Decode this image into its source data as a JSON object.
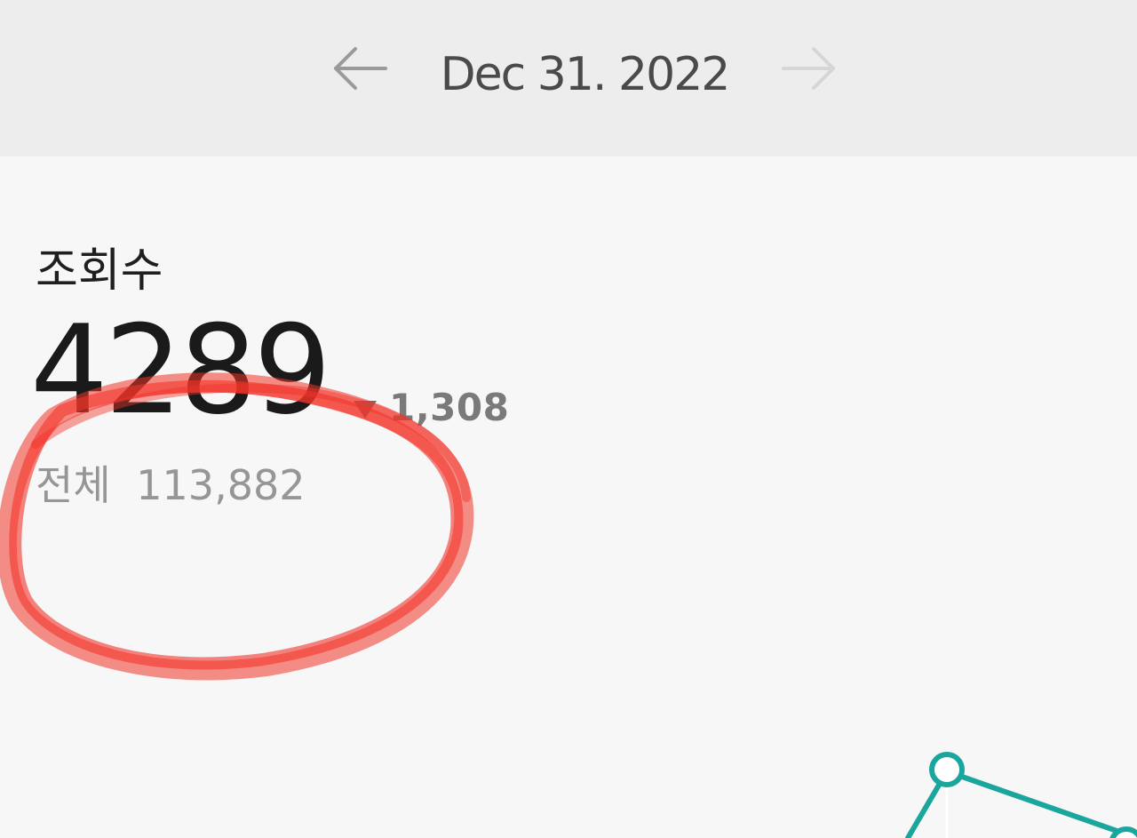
{
  "header": {
    "date": "Dec 31. 2022",
    "prev_icon": "arrow-left-icon",
    "next_icon": "arrow-right-icon"
  },
  "views": {
    "title": "조회수",
    "value": "4289",
    "change_icon": "down-triangle-icon",
    "change": "1,308",
    "total_label": "전체",
    "total_value": "113,882"
  },
  "colors": {
    "header_bg": "#ededed",
    "page_bg": "#f7f7f7",
    "chart_line": "#1aa59d",
    "annotation": "#f2342a"
  }
}
